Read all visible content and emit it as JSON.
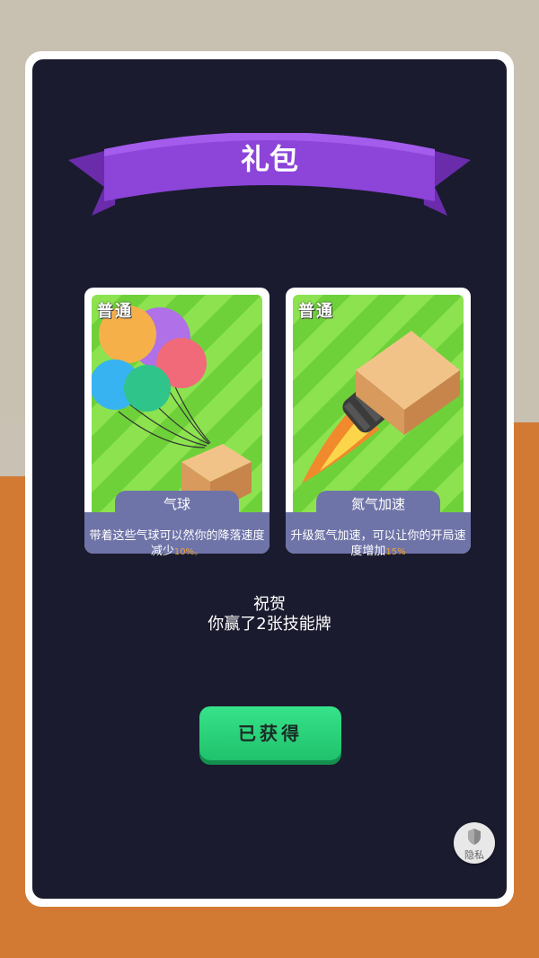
{
  "dialog": {
    "title": "礼包"
  },
  "cards": [
    {
      "rarity": "普通",
      "name": "气球",
      "desc_text": "带着这些气球可以然你的降落速度减少",
      "desc_percent": "10%。",
      "art_icon": "balloons-box-icon"
    },
    {
      "rarity": "普通",
      "name": "氮气加速",
      "desc_text": "升级氮气加速，可以让你的开局速度增加",
      "desc_percent": "15%",
      "art_icon": "rocket-box-icon"
    }
  ],
  "congrats": {
    "line1": "祝贺",
    "line2": "你赢了2张技能牌"
  },
  "obtained_button": {
    "label": "已获得"
  },
  "privacy": {
    "label": "隐私"
  },
  "colors": {
    "panel": "#1a1b2e",
    "ribbon": "#8a3fd6",
    "button": "#2bd67b",
    "card_label_bg": "#6f74a8"
  }
}
